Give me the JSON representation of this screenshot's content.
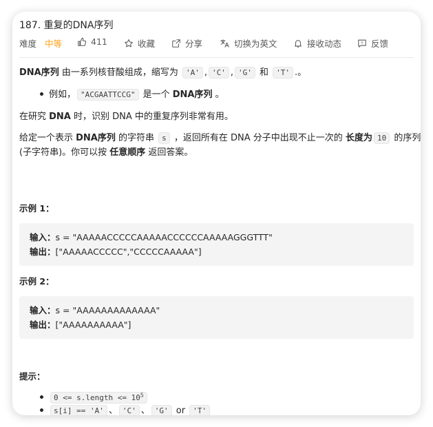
{
  "title": "187. 重复的DNA序列",
  "meta": {
    "difficulty_label": "难度",
    "difficulty_value": "中等",
    "likes": "411",
    "favorite": "收藏",
    "share": "分享",
    "switch_lang": "切换为英文",
    "notify": "接收动态",
    "feedback": "反馈"
  },
  "desc": {
    "p1_bold": "DNA序列",
    "p1_text": " 由一系列核苷酸组成，缩写为 ",
    "codes": [
      "'A'",
      "'C'",
      "'G'",
      "'T'"
    ],
    "comma": ",",
    "and": " 和 ",
    "p1_end": ".。",
    "bullet1_prefix": "例如，",
    "bullet1_code": "\"ACGAATTCCG\"",
    "bullet1_mid": " 是一个 ",
    "bullet1_bold": "DNA序列",
    "bullet1_end": " 。",
    "p2_a": "在研究 ",
    "p2_bold": "DNA",
    "p2_b": " 时，识别 DNA 中的重复序列非常有用。",
    "p3_a": "给定一个表示 ",
    "p3_bold1": "DNA序列",
    "p3_b": " 的字符串 ",
    "p3_code1": "s",
    "p3_c": " ，返回所有在 DNA 分子中出现不止一次的 ",
    "p3_bold2": "长度为",
    "p3_code2": "10",
    "p3_d": " 的序列",
    "p4_a": "(子字符串)。你可以按 ",
    "p4_bold": "任意顺序",
    "p4_b": " 返回答案。"
  },
  "example1": {
    "heading": "示例 1：",
    "input_label": "输入：",
    "input_value": "s = \"AAAAACCCCCAAAAACCCCCCAAAAAGGGTTT\"",
    "output_label": "输出：",
    "output_value": "[\"AAAAACCCCC\",\"CCCCCAAAAA\"]"
  },
  "example2": {
    "heading": "示例 2：",
    "input_label": "输入：",
    "input_value": "s = \"AAAAAAAAAAAAA\"",
    "output_label": "输出：",
    "output_value": "[\"AAAAAAAAAA\"]"
  },
  "constraints": {
    "heading": "提示：",
    "c1_code": "0 <= s.length <= 10",
    "c1_sup": "5",
    "c2_code1": "s[i] == 'A'",
    "sep": "、",
    "c2_code2": "'C'",
    "c2_code3": "'G'",
    "or": " or ",
    "c2_code4": "'T'"
  }
}
